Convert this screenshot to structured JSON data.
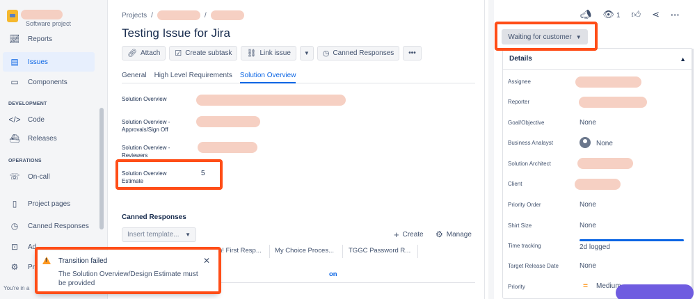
{
  "sidebar": {
    "project_type": "Software project",
    "items": [
      {
        "label": "Reports",
        "icon": "chart-line-icon"
      },
      {
        "label": "Issues",
        "icon": "issues-icon",
        "active": true
      },
      {
        "label": "Components",
        "icon": "components-icon"
      }
    ],
    "section_development": "DEVELOPMENT",
    "dev_items": [
      {
        "label": "Code",
        "icon": "code-icon"
      },
      {
        "label": "Releases",
        "icon": "releases-icon"
      }
    ],
    "section_operations": "OPERATIONS",
    "ops_items": [
      {
        "label": "On-call",
        "icon": "on-call-icon"
      }
    ],
    "bottom_items": [
      {
        "label": "Project pages",
        "icon": "pages-icon"
      },
      {
        "label": "Canned Responses",
        "icon": "canned-responses-icon"
      },
      {
        "label": "Ad",
        "icon": "add-icon"
      },
      {
        "label": "Pr",
        "icon": "settings-icon"
      }
    ],
    "footer": "You're in a"
  },
  "breadcrumb": {
    "projects": "Projects",
    "sep": "/"
  },
  "issue": {
    "title": "Testing Issue for Jira"
  },
  "toolbar": {
    "attach": "Attach",
    "create_subtask": "Create subtask",
    "link_issue": "Link issue",
    "canned_responses": "Canned Responses",
    "more": "•••"
  },
  "tabs": [
    "General",
    "High Level Requirements",
    "Solution Overview"
  ],
  "fields": {
    "solution_overview": "Solution Overview",
    "approvals": "Solution Overview - Approvals/Sign Off",
    "reviewers": "Solution Overview - Reviewers",
    "estimate_label": "Solution Overview Estimate",
    "estimate_value": "5"
  },
  "canned": {
    "title": "Canned Responses",
    "placeholder": "Insert template...",
    "create": "Create",
    "manage": "Manage",
    "chips": [
      "n! First Resp...",
      "My Choice Proces...",
      "TGGC Password R..."
    ],
    "tail": "on"
  },
  "toast": {
    "title": "Transition failed",
    "message": "The Solution Overview/Design Estimate must be provided"
  },
  "right": {
    "watch_count": "1",
    "status": "Waiting for customer",
    "details_title": "Details",
    "rows": [
      {
        "label": "Assignee",
        "value": ""
      },
      {
        "label": "Reporter",
        "value": ""
      },
      {
        "label": "Goal/Objective",
        "value": "None"
      },
      {
        "label": "Business Analayst",
        "value": "None"
      },
      {
        "label": "Solution Architect",
        "value": ""
      },
      {
        "label": "Client",
        "value": ""
      },
      {
        "label": "Priority Order",
        "value": "None"
      },
      {
        "label": "Shirt Size",
        "value": "None"
      },
      {
        "label": "Time tracking",
        "value": "2d logged"
      },
      {
        "label": "Target Release Date",
        "value": "None"
      },
      {
        "label": "Priority",
        "value": "Medium"
      }
    ]
  },
  "colors": {
    "accent": "#0c66e4",
    "annotation": "#ff4d17",
    "warning": "#ff991f"
  }
}
